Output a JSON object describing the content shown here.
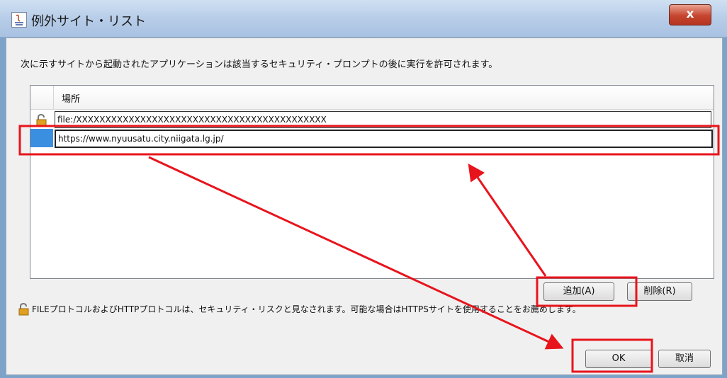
{
  "window": {
    "title": "例外サイト・リスト",
    "close_label": "x"
  },
  "dialog": {
    "description": "次に示すサイトから起動されたアプリケーションは該当するセキュリティ・プロンプトの後に実行を許可されます。",
    "table": {
      "column_header": "場所",
      "rows": [
        {
          "value": "file:/XXXXXXXXXXXXXXXXXXXXXXXXXXXXXXXXXXXXXXXXXXX",
          "icon": "lock-icon"
        },
        {
          "value": "https://www.nyuusatu.city.niigata.lg.jp/",
          "icon": ""
        }
      ]
    },
    "buttons": {
      "add": "追加(A)",
      "delete": "削除(R)",
      "ok": "OK",
      "cancel": "取消"
    },
    "note": "FILEプロトコルおよびHTTPプロトコルは、セキュリティ・リスクと見なされます。可能な場合はHTTPSサイトを使用することをお薦めします。"
  },
  "annotation_color": "#e8141c",
  "selection_color": "#3b8fe0"
}
